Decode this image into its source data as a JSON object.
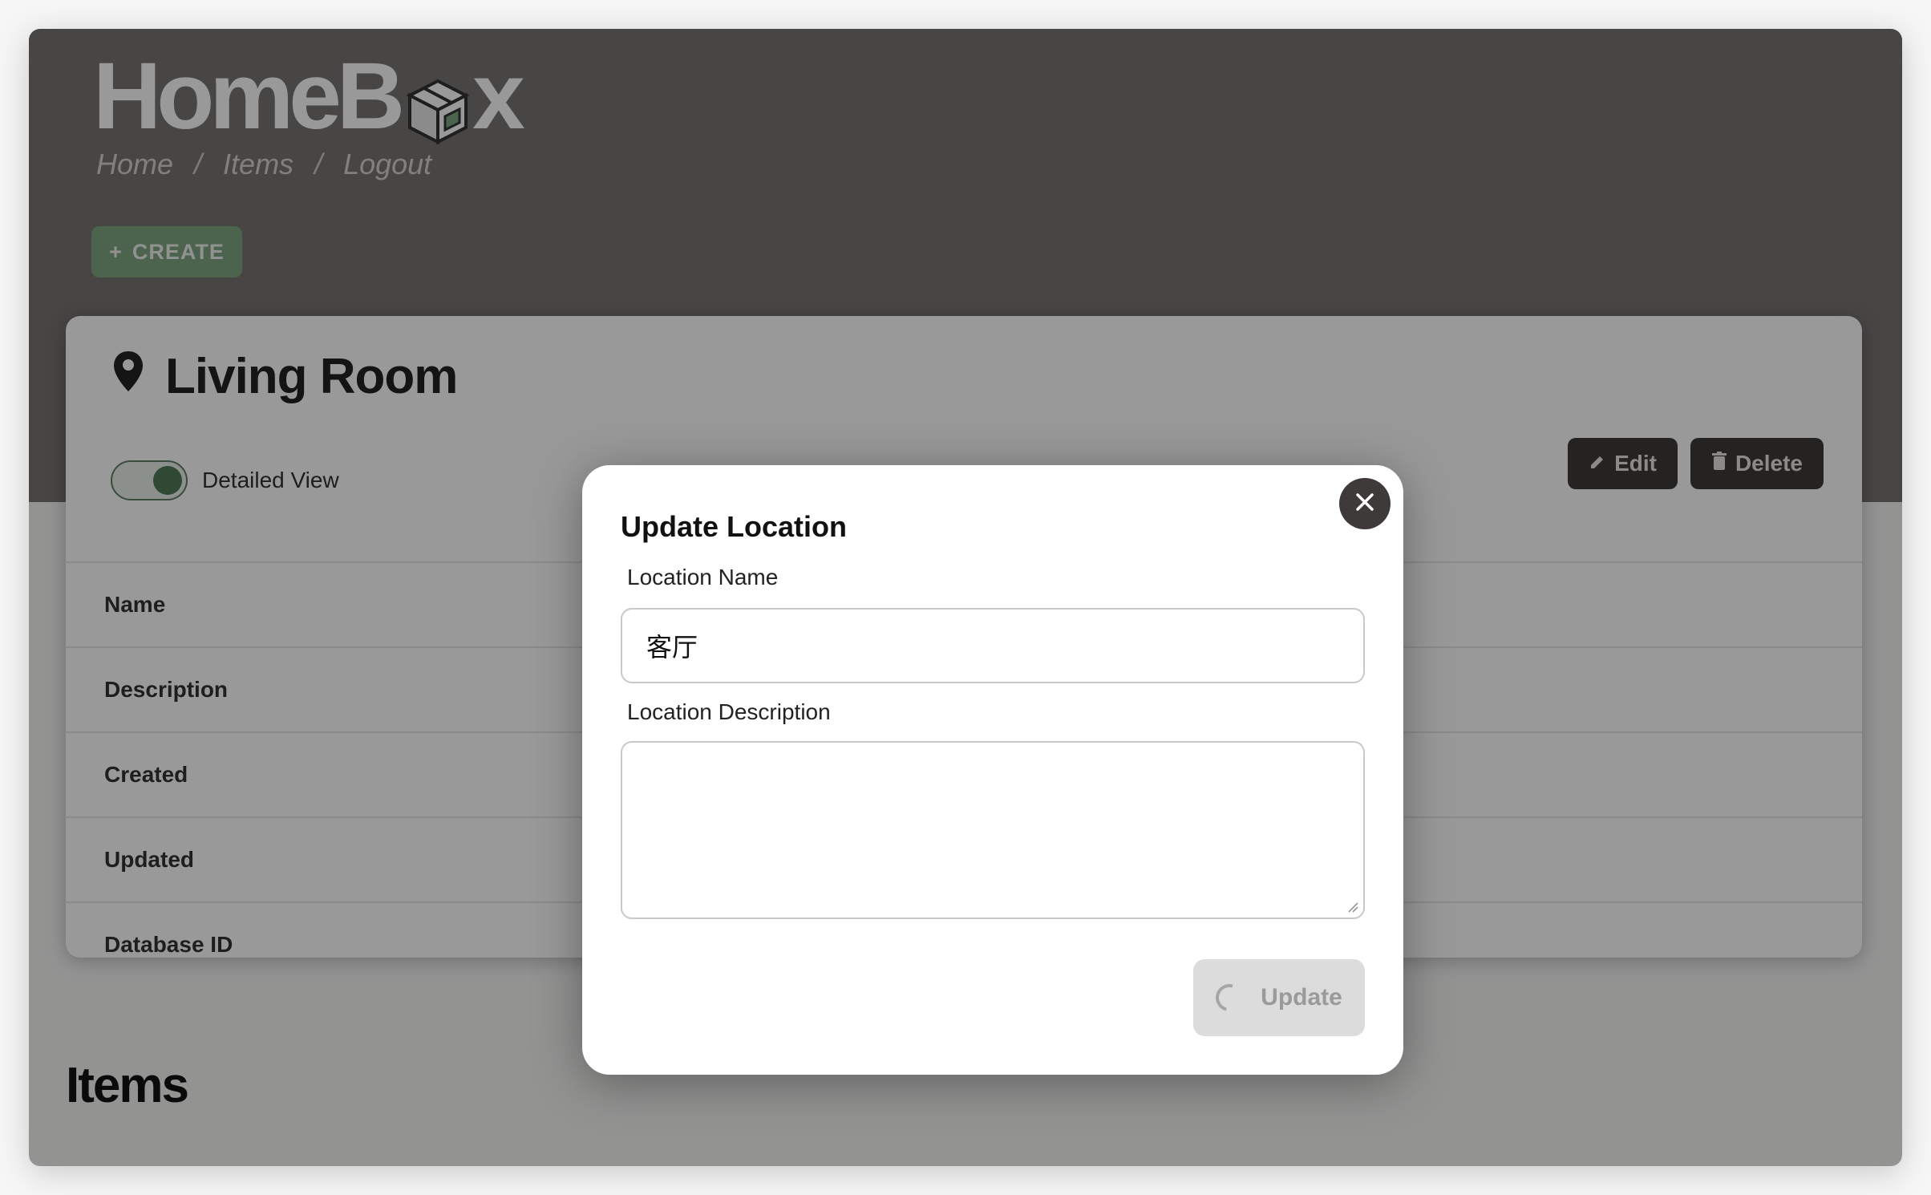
{
  "app": {
    "logo_text_left": "HomeB",
    "logo_text_right": "x"
  },
  "nav": {
    "items": [
      "Home",
      "Items",
      "Logout"
    ],
    "separator": "/"
  },
  "toolbar": {
    "create_label": "CREATE",
    "create_icon": "plus-icon"
  },
  "location": {
    "title": "Living Room",
    "icon": "map-pin-icon",
    "detailed_view_label": "Detailed View",
    "detailed_view_on": true,
    "edit_label": "Edit",
    "delete_label": "Delete",
    "rows": [
      "Name",
      "Description",
      "Created",
      "Updated",
      "Database ID"
    ]
  },
  "items_section": {
    "title": "Items"
  },
  "modal": {
    "title": "Update Location",
    "name_label": "Location Name",
    "name_value": "客厅",
    "description_label": "Location Description",
    "description_value": "",
    "update_label": "Update",
    "close_icon": "close-icon"
  },
  "colors": {
    "header_bg": "#787473",
    "accent_green": "#7fa583",
    "dark_button": "#3f3b3a",
    "overlay": "rgba(0,0,0,0.4)"
  }
}
